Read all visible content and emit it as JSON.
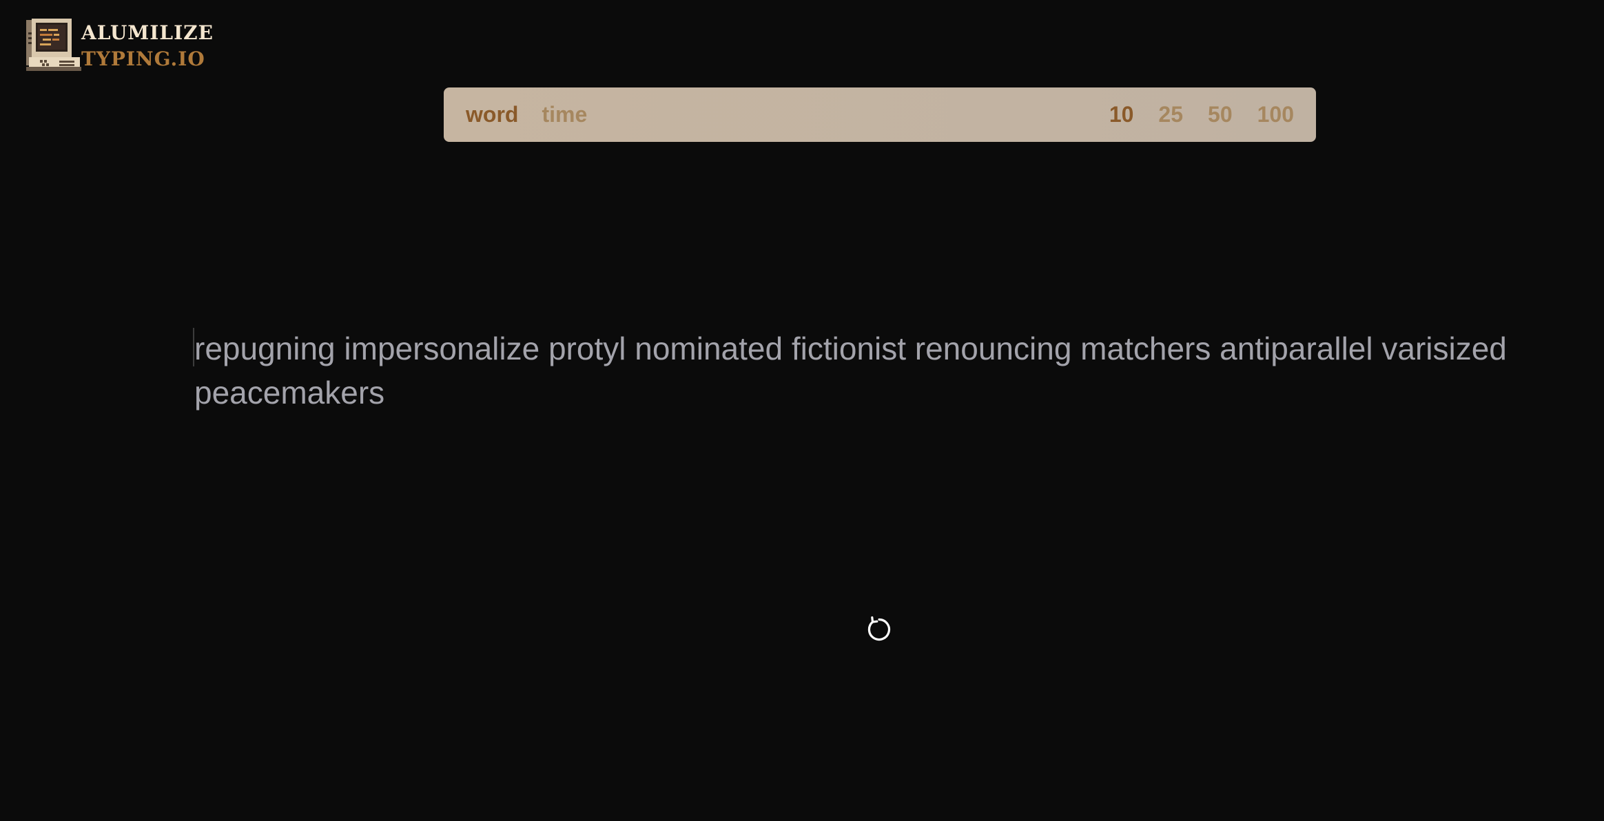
{
  "logo": {
    "line1": "ALUMILIZE",
    "line2": "TYPING.IO"
  },
  "toolbar": {
    "modes": [
      {
        "label": "word",
        "active": true
      },
      {
        "label": "time",
        "active": false
      }
    ],
    "counts": [
      {
        "label": "10",
        "active": true
      },
      {
        "label": "25",
        "active": false
      },
      {
        "label": "50",
        "active": false
      },
      {
        "label": "100",
        "active": false
      }
    ]
  },
  "typing": {
    "text": "repugning impersonalize protyl nominated fictionist renouncing matchers antiparallel varisized peacemakers"
  },
  "controls": {
    "restart_icon": "restart-icon"
  },
  "colors": {
    "background": "#0b0b0b",
    "toolbar_bg": "#c4b4a2",
    "active_option": "#8a5a2a",
    "inactive_option": "#a6875f",
    "text": "#a3a3ab",
    "logo_cream": "#f4e6cf",
    "logo_brown": "#b07a3a"
  }
}
